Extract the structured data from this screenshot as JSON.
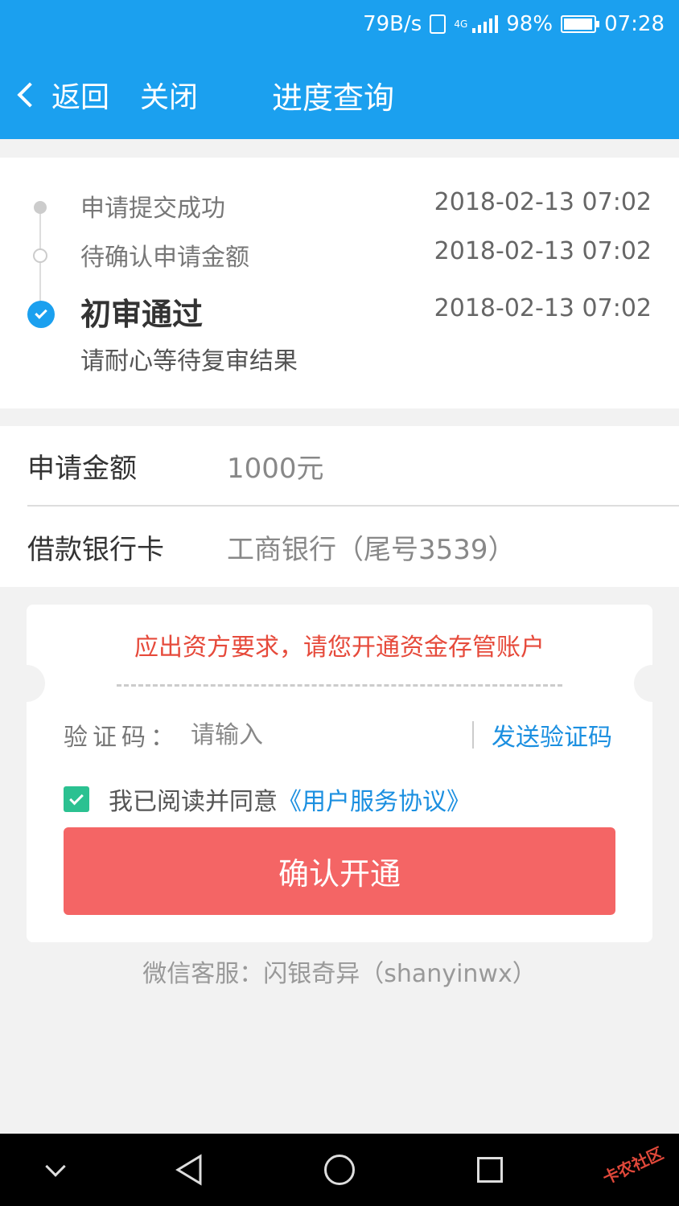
{
  "status_bar": {
    "speed": "79B/s",
    "network": "4G",
    "battery": "98%",
    "time": "07:28"
  },
  "header": {
    "back_label": "返回",
    "close_label": "关闭",
    "title": "进度查询",
    "color": "#1ba0ef"
  },
  "timeline": {
    "steps": [
      {
        "label": "申请提交成功",
        "time": "2018-02-13 07:02"
      },
      {
        "label": "待确认申请金额",
        "time": "2018-02-13 07:02"
      },
      {
        "label": "初审通过",
        "time": "2018-02-13 07:02"
      }
    ],
    "current_note": "请耐心等待复审结果"
  },
  "info": {
    "amount_label": "申请金额",
    "amount_value": "1000元",
    "card_label": "借款银行卡",
    "card_value": "工商银行（尾号3539）"
  },
  "account": {
    "notice": "应出资方要求，请您开通资金存管账户",
    "code_label": "验证码：",
    "code_placeholder": "请输入",
    "send_code": "发送验证码",
    "agree_text": "我已阅读并同意",
    "agreement_link": "《用户服务协议》",
    "confirm_button": "确认开通",
    "button_color": "#f46565"
  },
  "footer_note": "微信客服：闪银奇异（shanyinwx）",
  "watermark": "卡农社区"
}
